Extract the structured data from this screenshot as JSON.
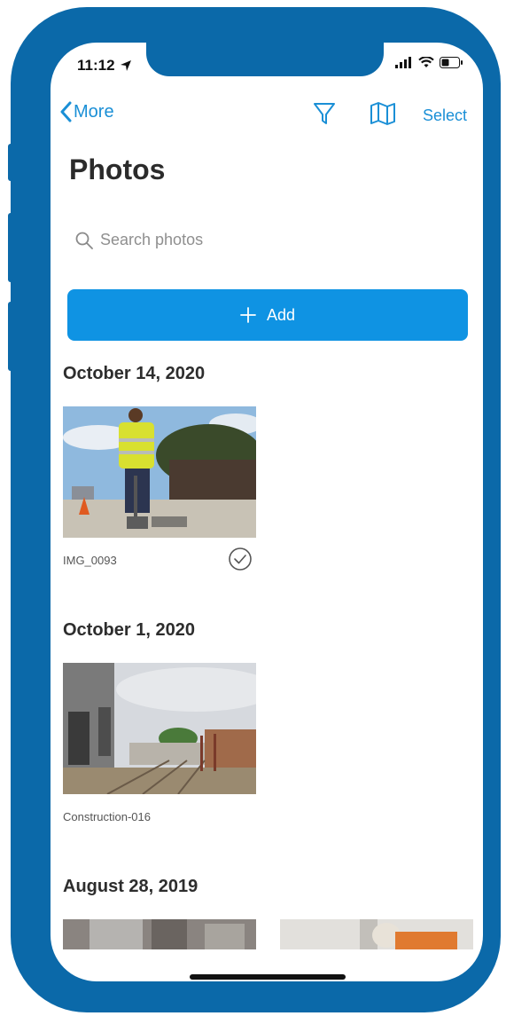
{
  "status": {
    "time": "11:12"
  },
  "nav": {
    "back_label": "More",
    "select_label": "Select"
  },
  "page": {
    "title": "Photos"
  },
  "search": {
    "placeholder": "Search photos"
  },
  "add_button": {
    "label": "Add",
    "color": "#0f93e3"
  },
  "accent_color": "#1a8fd6",
  "sections": [
    {
      "date": "October 14, 2020",
      "photos": [
        {
          "name": "IMG_0093",
          "selected": true
        }
      ]
    },
    {
      "date": "October 1, 2020",
      "photos": [
        {
          "name": "Construction-016",
          "selected": false
        }
      ]
    },
    {
      "date": "August 28, 2019",
      "photos": [
        {
          "name": ""
        },
        {
          "name": ""
        }
      ]
    }
  ]
}
